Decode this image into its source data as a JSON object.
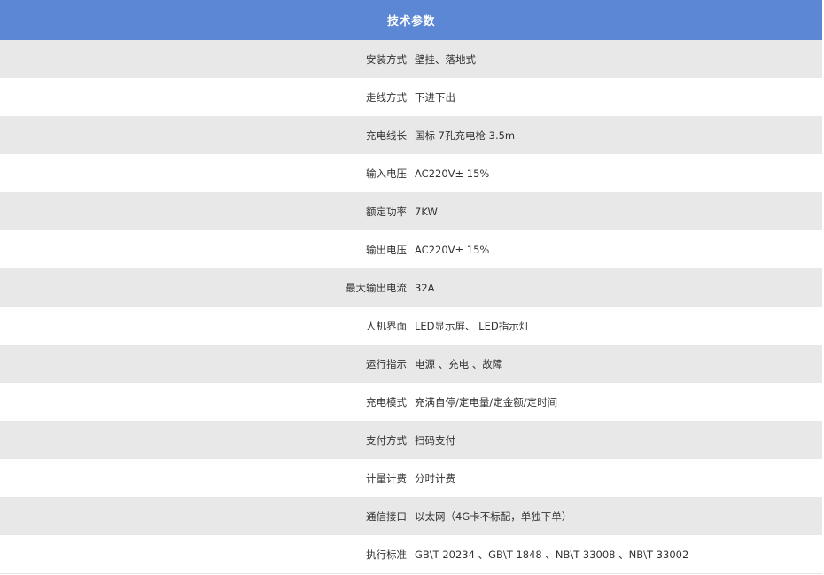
{
  "header": {
    "title": "技术参数"
  },
  "specs": [
    {
      "label": "安装方式",
      "value": "壁挂、落地式"
    },
    {
      "label": "走线方式",
      "value": "下进下出"
    },
    {
      "label": "充电线长",
      "value": "国标 7孔充电枪 3.5m"
    },
    {
      "label": "输入电压",
      "value": "AC220V± 15%"
    },
    {
      "label": "额定功率",
      "value": "7KW"
    },
    {
      "label": "输出电压",
      "value": "AC220V± 15%"
    },
    {
      "label": "最大输出电流",
      "value": "32A"
    },
    {
      "label": "人机界面",
      "value": "LED显示屏、 LED指示灯"
    },
    {
      "label": "运行指示",
      "value": "电源 、充电 、故障"
    },
    {
      "label": "充电模式",
      "value": "充满自停/定电量/定金额/定时间"
    },
    {
      "label": "支付方式",
      "value": "扫码支付"
    },
    {
      "label": "计量计费",
      "value": "分时计费"
    },
    {
      "label": "通信接口",
      "value": "以太网（4G卡不标配，单独下单）"
    },
    {
      "label": "执行标准",
      "value": "GB\\T 20234 、GB\\T 1848 、NB\\T 33008 、NB\\T 33002"
    }
  ],
  "colors": {
    "header_bg": "#5b87d5",
    "row_shaded": "#e8e8e8",
    "row_plain": "#ffffff",
    "text": "#333333"
  }
}
